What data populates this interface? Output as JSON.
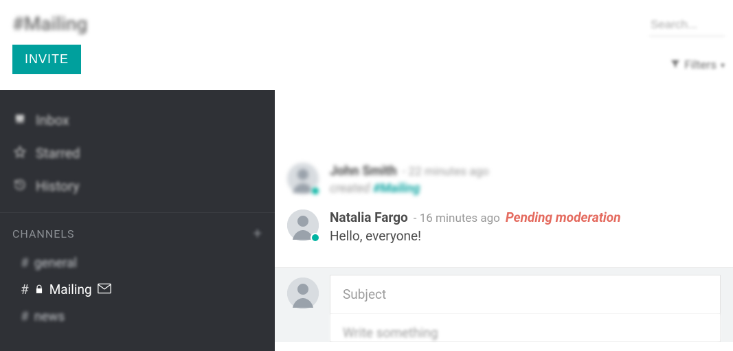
{
  "header": {
    "channel_title": "#Mailing",
    "invite_label": "INVITE",
    "search_placeholder": "Search...",
    "filters_label": "Filters"
  },
  "sidebar": {
    "nav": [
      {
        "icon": "inbox",
        "label": "Inbox"
      },
      {
        "icon": "star",
        "label": "Starred"
      },
      {
        "icon": "history",
        "label": "History"
      }
    ],
    "channels_header": "CHANNELS",
    "channels": [
      {
        "label": "general",
        "locked": false,
        "mail": false,
        "active": false,
        "blurred": true
      },
      {
        "label": "Mailing",
        "locked": true,
        "mail": true,
        "active": true,
        "blurred": false
      },
      {
        "label": "news",
        "locked": false,
        "mail": false,
        "active": false,
        "blurred": true
      }
    ]
  },
  "messages": [
    {
      "author": "John Smith",
      "timestamp": "22 minutes ago",
      "system_action": "created",
      "system_target": "#Mailing",
      "moderation": "",
      "text": "",
      "blurred": true
    },
    {
      "author": "Natalia Fargo",
      "timestamp": "16 minutes ago",
      "system_action": "",
      "system_target": "",
      "moderation": "Pending moderation",
      "text": "Hello, everyone!",
      "blurred": false
    }
  ],
  "composer": {
    "subject_placeholder": "Subject",
    "body_placeholder": "Write something"
  },
  "colors": {
    "accent": "#00a09d",
    "moderation": "#e46a5e",
    "sidebar_bg": "#2f3136"
  }
}
